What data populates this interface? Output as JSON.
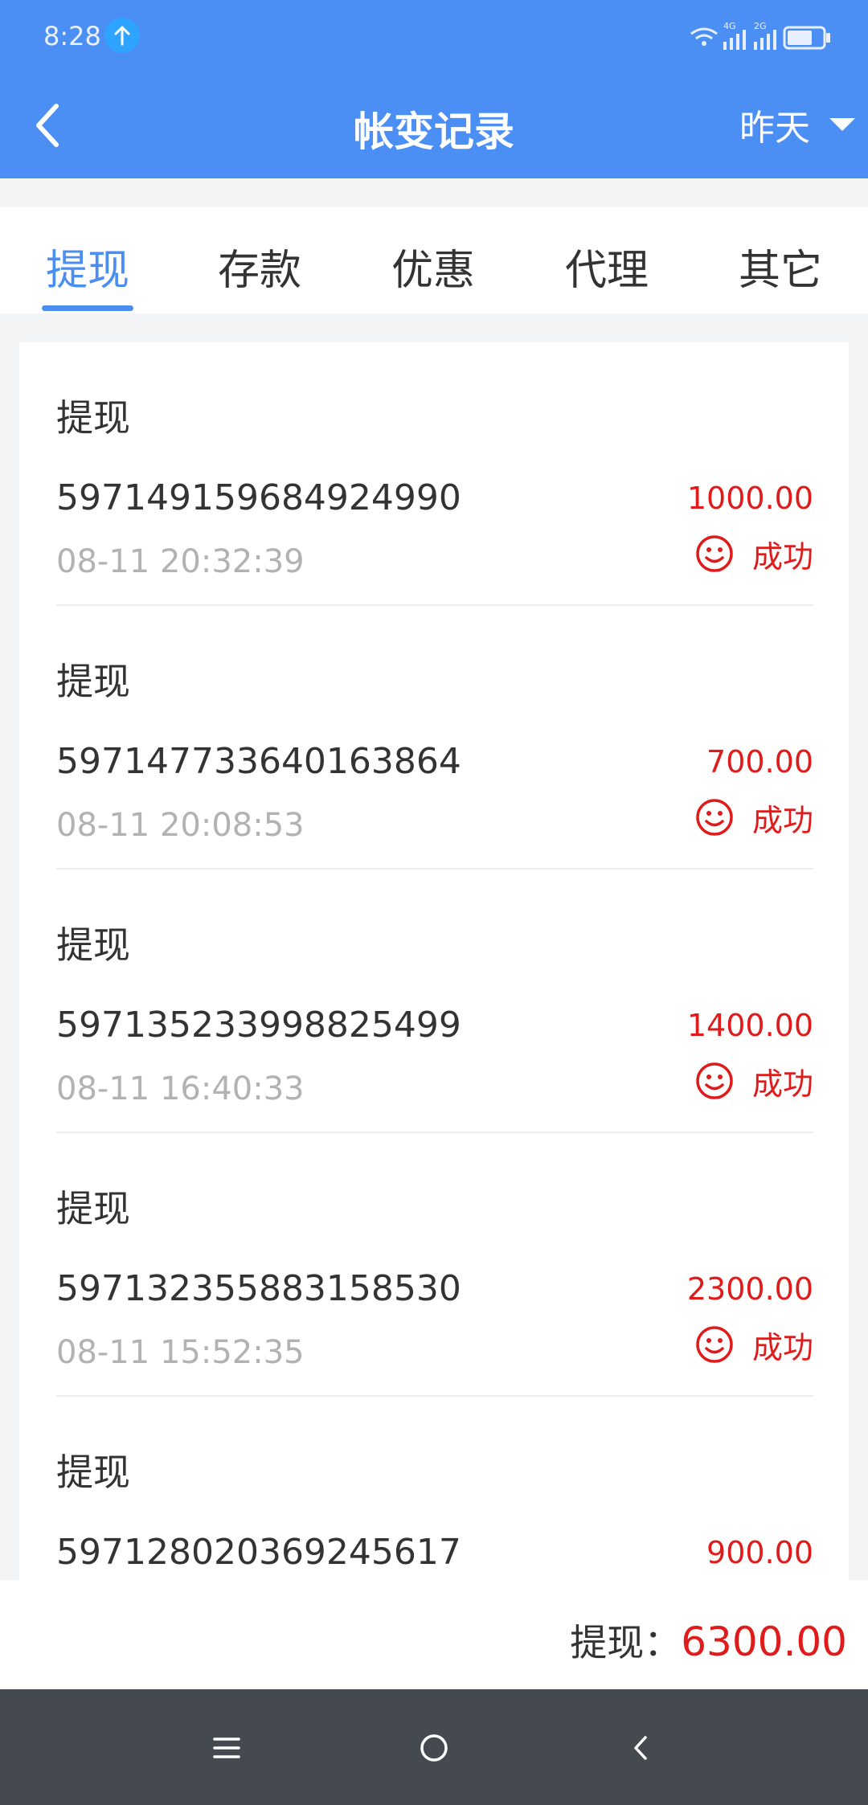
{
  "status_bar": {
    "time": "8:28",
    "network_labels": [
      "4G",
      "2G"
    ]
  },
  "header": {
    "title": "帐变记录",
    "date_filter": "昨天"
  },
  "tabs": [
    {
      "label": "提现",
      "active": true
    },
    {
      "label": "存款",
      "active": false
    },
    {
      "label": "优惠",
      "active": false
    },
    {
      "label": "代理",
      "active": false
    },
    {
      "label": "其它",
      "active": false
    }
  ],
  "records": [
    {
      "type": "提现",
      "id": "597149159684924990",
      "time": "08-11 20:32:39",
      "amount": "1000.00",
      "status": "成功"
    },
    {
      "type": "提现",
      "id": "597147733640163864",
      "time": "08-11 20:08:53",
      "amount": "700.00",
      "status": "成功"
    },
    {
      "type": "提现",
      "id": "597135233998825499",
      "time": "08-11 16:40:33",
      "amount": "1400.00",
      "status": "成功"
    },
    {
      "type": "提现",
      "id": "597132355883158530",
      "time": "08-11 15:52:35",
      "amount": "2300.00",
      "status": "成功"
    },
    {
      "type": "提现",
      "id": "597128020369245617",
      "time": "",
      "amount": "900.00",
      "status": ""
    }
  ],
  "summary": {
    "label": "提现：",
    "amount": "6300.00"
  },
  "colors": {
    "primary": "#4b8ff5",
    "tab_active": "#4a8ef2",
    "amount_red": "#e01b1b",
    "nav_bar": "#444a50"
  },
  "icons": {
    "back": "chevron-left-icon",
    "dropdown": "caret-down-icon",
    "status": "smile-icon",
    "nav": [
      "menu-icon",
      "home-icon",
      "back-icon"
    ]
  }
}
